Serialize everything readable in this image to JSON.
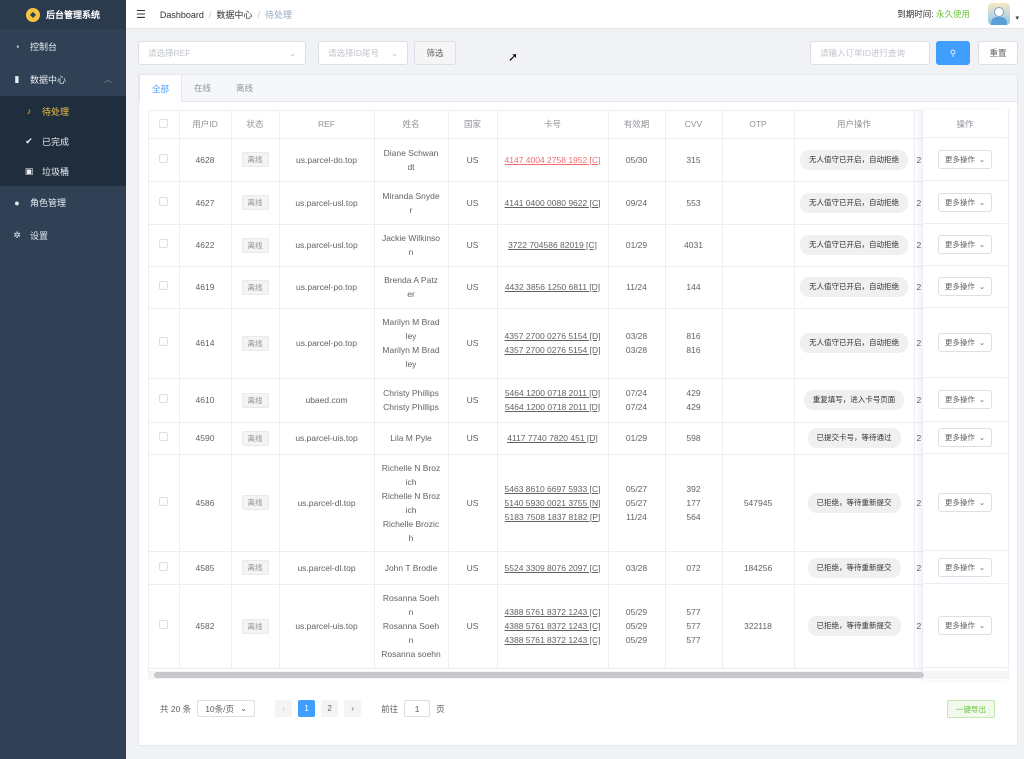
{
  "app": {
    "title": "后台管理系统",
    "logo_glyph": "◆"
  },
  "sidebar": {
    "items": [
      {
        "label": "控制台",
        "icon": "dashboard-icon",
        "glyph": "◔"
      },
      {
        "label": "数据中心",
        "icon": "chart-icon",
        "glyph": "▮"
      },
      {
        "label": "角色管理",
        "icon": "user-icon",
        "glyph": "●"
      },
      {
        "label": "设置",
        "icon": "gear-icon",
        "glyph": "✲"
      }
    ],
    "sub_items": [
      {
        "label": "待处理",
        "icon": "bell-icon",
        "glyph": "♪"
      },
      {
        "label": "已完成",
        "icon": "check-circle-icon",
        "glyph": "✔"
      },
      {
        "label": "垃圾桶",
        "icon": "trash-icon",
        "glyph": "▣"
      }
    ],
    "expand_glyph": "︿"
  },
  "header": {
    "menu_glyph": "☰",
    "breadcrumb": [
      "Dashboard",
      "数据中心",
      "待处理"
    ],
    "breadcrumb_sep": "/",
    "expire_label": "到期时间:",
    "expire_value": "永久使用",
    "caret": "▾"
  },
  "filters": {
    "ref_placeholder": "请选择REF",
    "card_placeholder": "请选择ID尾号",
    "filter_btn": "筛选",
    "search_placeholder": "请输入订单ID进行查询",
    "search_glyph": "⚲",
    "reset_btn": "重置",
    "dropdown_glyph": "⌄"
  },
  "tabs": [
    "全部",
    "在线",
    "离线"
  ],
  "table": {
    "headers": [
      "用户ID",
      "状态",
      "REF",
      "姓名",
      "国家",
      "卡号",
      "有效期",
      "CVV",
      "OTP",
      "用户操作",
      "操作"
    ],
    "rows": [
      {
        "id": "4628",
        "status": "离线",
        "ref": "us.parcel-do.top",
        "names": [
          "Diane Schwan",
          "dt"
        ],
        "country": "US",
        "cards": [
          "4147 4004 2758 1952 [C]"
        ],
        "card_red": true,
        "exp": [
          "05/30"
        ],
        "cvv": [
          "315"
        ],
        "otp": "",
        "op": "无人值守已开启，自动拒绝",
        "cut": "2",
        "more": "更多操作"
      },
      {
        "id": "4627",
        "status": "离线",
        "ref": "us.parcel-usl.top",
        "names": [
          "Miranda Snyde",
          "r"
        ],
        "country": "US",
        "cards": [
          "4141 0400 0080 9622 [C]"
        ],
        "exp": [
          "09/24"
        ],
        "cvv": [
          "553"
        ],
        "otp": "",
        "op": "无人值守已开启，自动拒绝",
        "cut": "2",
        "more": "更多操作"
      },
      {
        "id": "4622",
        "status": "离线",
        "ref": "us.parcel-usl.top",
        "names": [
          "Jackie Wilkinso",
          "n"
        ],
        "country": "US",
        "cards": [
          "3722 704586 82019 [C]"
        ],
        "exp": [
          "01/29"
        ],
        "cvv": [
          "4031"
        ],
        "otp": "",
        "op": "无人值守已开启，自动拒绝",
        "cut": "2",
        "more": "更多操作"
      },
      {
        "id": "4619",
        "status": "离线",
        "ref": "us.parcel-po.top",
        "names": [
          "Brenda A Patz",
          "er"
        ],
        "country": "US",
        "cards": [
          "4432 3856 1250 6811 [D]"
        ],
        "exp": [
          "11/24"
        ],
        "cvv": [
          "144"
        ],
        "otp": "",
        "op": "无人值守已开启，自动拒绝",
        "cut": "2",
        "more": "更多操作"
      },
      {
        "id": "4614",
        "status": "离线",
        "ref": "us.parcel-po.top",
        "names": [
          "Marilyn M Brad",
          "ley",
          "Marilyn M Brad",
          "ley"
        ],
        "country": "US",
        "cards": [
          "4357 2700 0276 5154 [D]",
          "4357 2700 0276 5154 [D]"
        ],
        "exp": [
          "03/28",
          "03/28"
        ],
        "cvv": [
          "816",
          "816"
        ],
        "otp": "",
        "op": "无人值守已开启，自动拒绝",
        "cut": "2",
        "more": "更多操作"
      },
      {
        "id": "4610",
        "status": "离线",
        "ref": "ubaed.com",
        "names": [
          "Christy Phillips",
          "Christy Phillips"
        ],
        "country": "US",
        "cards": [
          "5464 1200 0718 2011 [D]",
          "5464 1200 0718 2011 [D]"
        ],
        "exp": [
          "07/24",
          "07/24"
        ],
        "cvv": [
          "429",
          "429"
        ],
        "otp": "",
        "op": "重复填写，进入卡号页面",
        "cut": "2",
        "more": "更多操作"
      },
      {
        "id": "4590",
        "status": "离线",
        "ref": "us.parcel-uis.top",
        "names": [
          "Lila M Pyle"
        ],
        "country": "US",
        "cards": [
          "4117 7740 7820 451 [D]"
        ],
        "exp": [
          "01/29"
        ],
        "cvv": [
          "598"
        ],
        "otp": "",
        "op": "已提交卡号，等待通过",
        "cut": "2",
        "more": "更多操作"
      },
      {
        "id": "4586",
        "status": "离线",
        "ref": "us.parcel-dl.top",
        "names": [
          "Richelle N Broz",
          "ich",
          "Richelle N Broz",
          "ich",
          "Richelle Brozic",
          "h"
        ],
        "country": "US",
        "cards": [
          "5463 8610 6697 5933 [C]",
          "5140 5930 0021 3755 [N]",
          "5183 7508 1837 8182 [P]"
        ],
        "exp": [
          "05/27",
          "05/27",
          "11/24"
        ],
        "cvv": [
          "392",
          "177",
          "564"
        ],
        "otp": "547945",
        "op": "已拒绝，等待重新提交",
        "cut": "2",
        "more": "更多操作"
      },
      {
        "id": "4585",
        "status": "离线",
        "ref": "us.parcel-dl.top",
        "names": [
          "John T Brodie"
        ],
        "country": "US",
        "cards": [
          "5524 3309 8076 2097 [C]"
        ],
        "exp": [
          "03/28"
        ],
        "cvv": [
          "072"
        ],
        "otp": "184256",
        "op": "已拒绝，等待重新提交",
        "cut": "2",
        "more": "更多操作"
      },
      {
        "id": "4582",
        "status": "离线",
        "ref": "us.parcel-uis.top",
        "names": [
          "Rosanna Soeh",
          "n",
          "Rosanna Soeh",
          "n",
          "Rosanna soehn"
        ],
        "country": "US",
        "cards": [
          "4388 5761 8372 1243 [C]",
          "4388 5761 8372 1243 [C]",
          "4388 5761 8372 1243 [C]"
        ],
        "exp": [
          "05/29",
          "05/29",
          "05/29"
        ],
        "cvv": [
          "577",
          "577",
          "577"
        ],
        "otp": "322118",
        "op": "已拒绝，等待重新提交",
        "cut": "2",
        "more": "更多操作"
      }
    ]
  },
  "pagination": {
    "total": "共 20 条",
    "page_size": "10条/页",
    "pages": [
      "1",
      "2"
    ],
    "prev": "‹",
    "next": "›",
    "goto_label": "前往",
    "goto_value": "1",
    "goto_suffix": "页",
    "current_page": 1
  },
  "export_btn": "一键导出",
  "colors": {
    "primary": "#409eff",
    "sidebar": "#304156",
    "active": "#f5c242",
    "success": "#67c23a",
    "danger": "#f56c6c"
  }
}
